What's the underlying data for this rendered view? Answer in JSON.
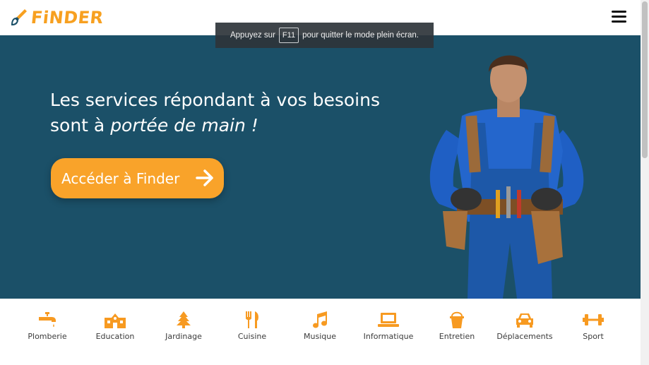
{
  "header": {
    "logo_text": "FiNDER",
    "logo_icon": "paintbrush-icon",
    "menu_icon": "hamburger-menu-icon"
  },
  "fullscreen_notice": {
    "prefix": "Appuyez sur",
    "key": "F11",
    "suffix": "pour quitter le mode plein écran."
  },
  "hero": {
    "headline_line1": "Les services répondant à vos besoins",
    "headline_line2_prefix": "sont à ",
    "headline_line2_emphasis": "portée de main !",
    "cta_label": "Accéder à Finder",
    "cta_icon": "arrow-right-icon",
    "image": "worker-with-tool-belt"
  },
  "categories": [
    {
      "label": "Plomberie",
      "icon": "faucet-icon"
    },
    {
      "label": "Education",
      "icon": "school-icon"
    },
    {
      "label": "Jardinage",
      "icon": "tree-icon"
    },
    {
      "label": "Cuisine",
      "icon": "utensils-icon"
    },
    {
      "label": "Musique",
      "icon": "music-note-icon"
    },
    {
      "label": "Informatique",
      "icon": "laptop-icon"
    },
    {
      "label": "Entretien",
      "icon": "bucket-icon"
    },
    {
      "label": "Déplacements",
      "icon": "car-icon"
    },
    {
      "label": "Sport",
      "icon": "dumbbell-icon"
    }
  ],
  "colors": {
    "accent": "#f9a32a",
    "hero_bg": "#1b5068",
    "text_dark": "#3b3b3b"
  }
}
